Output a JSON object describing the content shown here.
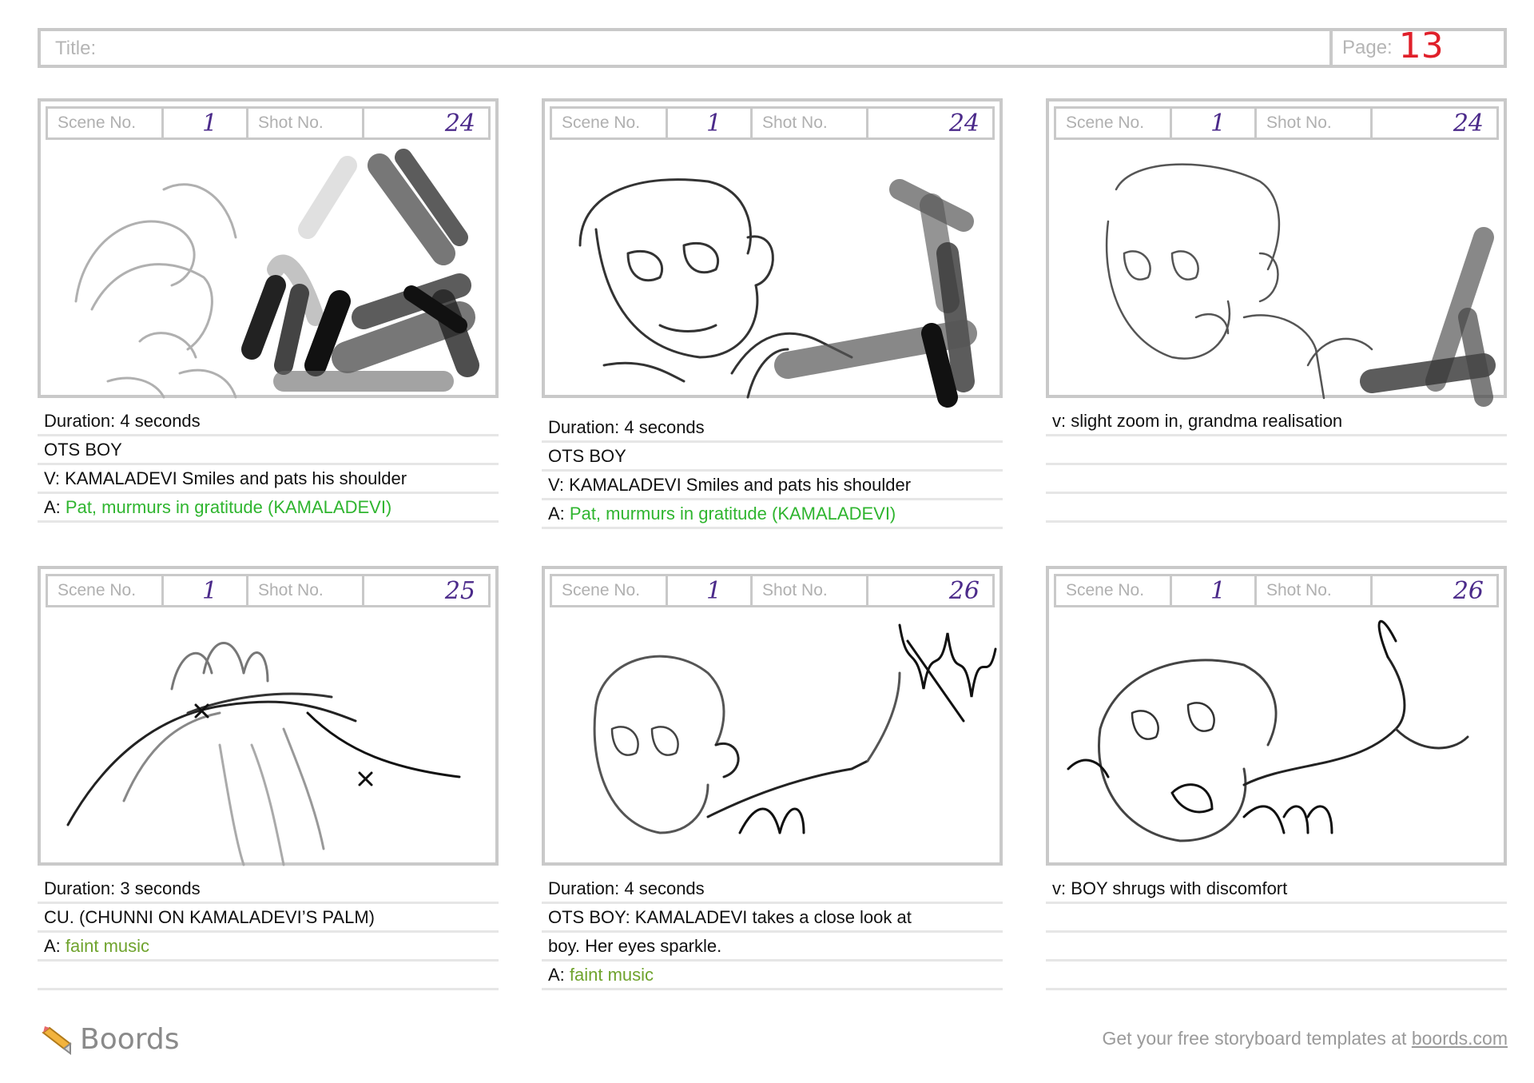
{
  "header": {
    "title_label": "Title:",
    "page_label": "Page:",
    "page_number": "13"
  },
  "labels": {
    "scene": "Scene No.",
    "shot": "Shot No."
  },
  "panels": [
    {
      "scene": "1",
      "shot": "24",
      "notes": [
        {
          "prefix": "",
          "text": "Duration: 4 seconds",
          "style": ""
        },
        {
          "prefix": "",
          "text": "OTS BOY",
          "style": ""
        },
        {
          "prefix": "",
          "text": "V: KAMALADEVI Smiles and pats his shoulder",
          "style": ""
        },
        {
          "prefix": "A: ",
          "text": "Pat, murmurs in gratitude (KAMALADEVI)",
          "style": "green"
        }
      ]
    },
    {
      "scene": "1",
      "shot": "24",
      "notes": [
        {
          "prefix": "",
          "text": "Duration: 4 seconds",
          "style": ""
        },
        {
          "prefix": "",
          "text": "OTS BOY",
          "style": ""
        },
        {
          "prefix": "",
          "text": "V: KAMALADEVI Smiles and pats his shoulder",
          "style": ""
        },
        {
          "prefix": "A: ",
          "text": "Pat, murmurs in gratitude (KAMALADEVI)",
          "style": "green"
        }
      ]
    },
    {
      "scene": "1",
      "shot": "24",
      "notes": [
        {
          "prefix": "",
          "text": "v: slight zoom in, grandma realisation",
          "style": ""
        },
        {
          "prefix": "",
          "text": "",
          "style": ""
        },
        {
          "prefix": "",
          "text": "",
          "style": ""
        },
        {
          "prefix": "",
          "text": "",
          "style": ""
        }
      ]
    },
    {
      "scene": "1",
      "shot": "25",
      "notes": [
        {
          "prefix": "",
          "text": "Duration: 3 seconds",
          "style": ""
        },
        {
          "prefix": "",
          "text": "CU. (CHUNNI ON KAMALADEVI’S PALM)",
          "style": ""
        },
        {
          "prefix": "A: ",
          "text": "faint music",
          "style": "olive"
        },
        {
          "prefix": "",
          "text": "",
          "style": ""
        }
      ]
    },
    {
      "scene": "1",
      "shot": "26",
      "notes": [
        {
          "prefix": "",
          "text": "Duration: 4 seconds",
          "style": ""
        },
        {
          "prefix": "",
          "text": "OTS BOY: KAMALADEVI takes a close look at",
          "style": ""
        },
        {
          "prefix": "",
          "text": "boy. Her eyes sparkle.",
          "style": ""
        },
        {
          "prefix": "A: ",
          "text": "faint music",
          "style": "olive"
        }
      ]
    },
    {
      "scene": "1",
      "shot": "26",
      "notes": [
        {
          "prefix": "",
          "text": "v: BOY shrugs with discomfort",
          "style": ""
        },
        {
          "prefix": "",
          "text": "",
          "style": ""
        },
        {
          "prefix": "",
          "text": "",
          "style": ""
        },
        {
          "prefix": "",
          "text": "",
          "style": ""
        }
      ]
    }
  ],
  "footer": {
    "brand": "Boords",
    "tagline": "Get your free storyboard templates at ",
    "link": "boords.com"
  },
  "colors": {
    "border": "#c9c9c9",
    "handwriting": "#4b2a8a",
    "page_number": "#e0202a",
    "audio_green": "#2fb52f",
    "audio_olive": "#6fa32d"
  }
}
